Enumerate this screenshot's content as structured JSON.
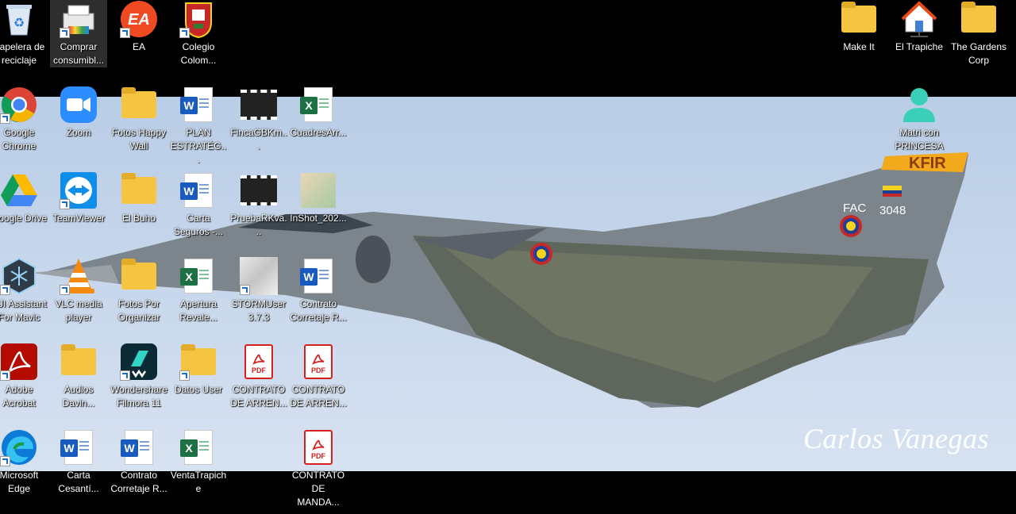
{
  "wallpaper": {
    "signature": "Carlos Vanegas",
    "jet_markings": {
      "tail_code": "KFIR",
      "designation": "FAC",
      "serial": "3048"
    }
  },
  "icons": [
    {
      "id": "recycle",
      "label": "Papelera de reciclaje",
      "icon": "recycle-bin-icon",
      "shortcut": false
    },
    {
      "id": "comprar",
      "label": "Comprar consumibl...",
      "icon": "printer-icon",
      "shortcut": true,
      "selected": true
    },
    {
      "id": "ea",
      "label": "EA",
      "icon": "ea-icon",
      "shortcut": true
    },
    {
      "id": "colegio",
      "label": "Colegio Colom...",
      "icon": "school-crest-icon",
      "shortcut": true
    },
    {
      "id": "make-it",
      "label": "Make It",
      "icon": "folder-icon",
      "shortcut": false
    },
    {
      "id": "el-trapiche",
      "label": "El Trapiche",
      "icon": "home-network-icon",
      "shortcut": false
    },
    {
      "id": "gardens",
      "label": "The Gardens Corp",
      "icon": "folder-icon",
      "shortcut": false
    },
    {
      "id": "chrome",
      "label": "Google Chrome",
      "icon": "chrome-icon",
      "shortcut": true
    },
    {
      "id": "zoom",
      "label": "Zoom",
      "icon": "zoom-icon",
      "shortcut": false
    },
    {
      "id": "fotos-happy",
      "label": "Fotos Happy Wall",
      "icon": "folder-icon",
      "shortcut": false
    },
    {
      "id": "plan",
      "label": "PLAN ESTRATÉG...",
      "icon": "word-icon",
      "shortcut": false
    },
    {
      "id": "finca",
      "label": "FincaGBKm...",
      "icon": "video-icon",
      "shortcut": false
    },
    {
      "id": "cuadres",
      "label": "CuadresArr...",
      "icon": "excel-icon",
      "shortcut": false
    },
    {
      "id": "matri",
      "label": "Matri con PRINCESA",
      "icon": "user-icon",
      "shortcut": false
    },
    {
      "id": "gdrive",
      "label": "Google Drive",
      "icon": "google-drive-icon",
      "shortcut": false
    },
    {
      "id": "teamviewer",
      "label": "TeamViewer",
      "icon": "teamviewer-icon",
      "shortcut": true
    },
    {
      "id": "elbuho",
      "label": "El Buho",
      "icon": "folder-icon",
      "shortcut": false
    },
    {
      "id": "carta-seguros",
      "label": "Carta Seguros -...",
      "icon": "word-icon",
      "shortcut": false
    },
    {
      "id": "prueba",
      "label": "PruebaRKva...",
      "icon": "video-icon",
      "shortcut": false
    },
    {
      "id": "inshot",
      "label": "InShot_202...",
      "icon": "photo-icon",
      "shortcut": false
    },
    {
      "id": "djiassistant",
      "label": "DJI Assistant For Mavic",
      "icon": "dji-icon",
      "shortcut": true
    },
    {
      "id": "vlc",
      "label": "VLC media player",
      "icon": "vlc-icon",
      "shortcut": true
    },
    {
      "id": "fotos-por",
      "label": "Fotos Por Organizar",
      "icon": "folder-icon",
      "shortcut": false
    },
    {
      "id": "apertura",
      "label": "Apertura Revale...",
      "icon": "excel-icon",
      "shortcut": false
    },
    {
      "id": "storm",
      "label": "STORMUser 3.7.3",
      "icon": "app-icon",
      "shortcut": true
    },
    {
      "id": "contrato-corretaje",
      "label": "Contrato Corretaje R...",
      "icon": "word-icon",
      "shortcut": false
    },
    {
      "id": "acrobat",
      "label": "Adobe Acrobat",
      "icon": "acrobat-icon",
      "shortcut": true
    },
    {
      "id": "audios",
      "label": "Audios Davin...",
      "icon": "folder-icon",
      "shortcut": false
    },
    {
      "id": "filmora",
      "label": "Wondershare Filmora 11",
      "icon": "filmora-icon",
      "shortcut": true
    },
    {
      "id": "datos-user",
      "label": "Datos User",
      "icon": "folder-icon",
      "shortcut": true
    },
    {
      "id": "contrato-arren1",
      "label": "CONTRATO DE ARREN...",
      "icon": "pdf-icon",
      "shortcut": false
    },
    {
      "id": "contrato-arren2",
      "label": "CONTRATO DE ARREN...",
      "icon": "pdf-icon",
      "shortcut": false
    },
    {
      "id": "edge",
      "label": "Microsoft Edge",
      "icon": "edge-icon",
      "shortcut": true
    },
    {
      "id": "carta-cesanti",
      "label": "Carta Cesantí...",
      "icon": "word-icon",
      "shortcut": false
    },
    {
      "id": "contrato-corretaje2",
      "label": "Contrato Corretaje R...",
      "icon": "word-icon",
      "shortcut": false
    },
    {
      "id": "ventatrapiche",
      "label": "VentaTrapiche",
      "icon": "excel-icon",
      "shortcut": false
    },
    {
      "id": "contrato-manda",
      "label": "CONTRATO DE MANDA...",
      "icon": "pdf-icon",
      "shortcut": false
    }
  ]
}
